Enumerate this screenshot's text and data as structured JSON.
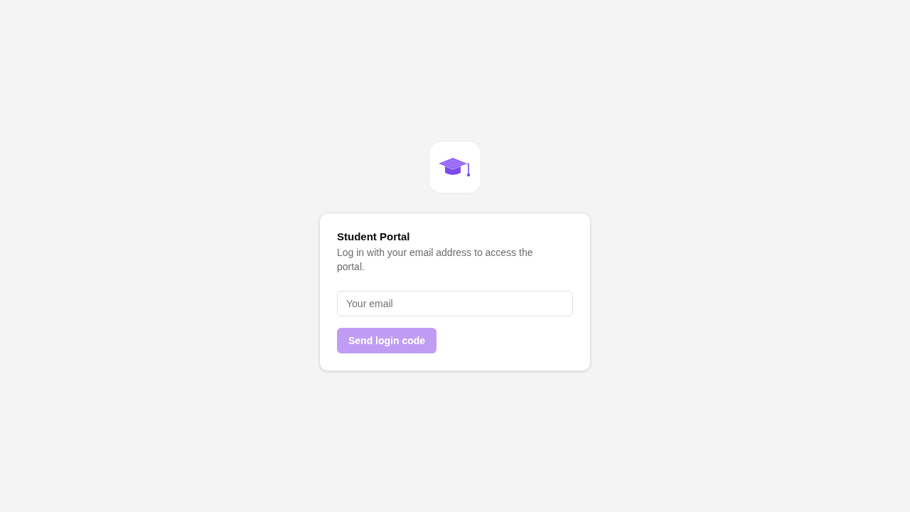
{
  "card": {
    "title": "Student Portal",
    "description": "Log in with your email address to access the portal."
  },
  "email_field": {
    "placeholder": "Your email"
  },
  "button": {
    "label": "Send login code",
    "disabled": true
  }
}
